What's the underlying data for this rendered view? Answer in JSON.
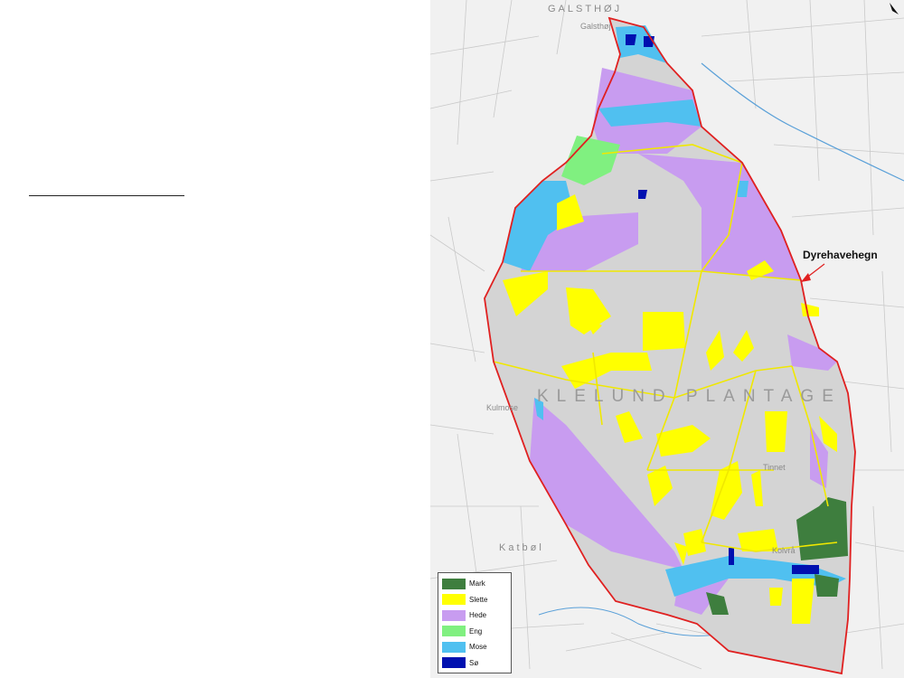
{
  "map": {
    "annotation": "Dyrehavehegn",
    "place_labels": {
      "galsthoj": "GALSTHØJ",
      "galsthoj_small": "Galsthøj",
      "plantage": "KLELUND PLANTAGE",
      "kulmose": "Kulmose",
      "katbol": "Katbøl",
      "tinnet": "Tinnet",
      "kolvraa": "Kolvrå"
    },
    "legend": {
      "items": [
        {
          "label": "Mark",
          "color": "#3e7e3e"
        },
        {
          "label": "Slette",
          "color": "#ffff00"
        },
        {
          "label": "Hede",
          "color": "#c89cf0"
        },
        {
          "label": "Eng",
          "color": "#80f080"
        },
        {
          "label": "Mose",
          "color": "#50c0f0"
        },
        {
          "label": "Sø",
          "color": "#0010b0"
        }
      ]
    },
    "colors": {
      "boundary": "#e02020",
      "paths": "#f0e800",
      "forest": "#d4d4d4",
      "background": "#f1f1f1"
    }
  }
}
